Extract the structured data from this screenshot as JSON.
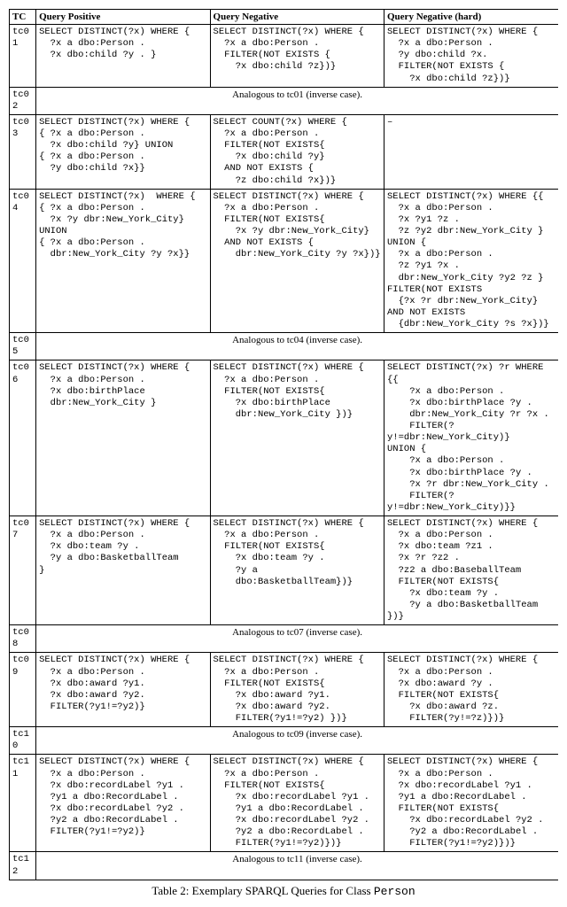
{
  "headers": {
    "tc": "TC",
    "pos": "Query Positive",
    "neg": "Query Negative",
    "negh": "Query Negative (hard)"
  },
  "rows": {
    "tc01": {
      "tc": "tc01",
      "pos": "SELECT DISTINCT(?x) WHERE {\n  ?x a dbo:Person .\n  ?x dbo:child ?y . }",
      "neg": "SELECT DISTINCT(?x) WHERE {\n  ?x a dbo:Person .\n  FILTER(NOT EXISTS {\n    ?x dbo:child ?z})}",
      "negh": "SELECT DISTINCT(?x) WHERE {\n  ?x a dbo:Person .\n  ?y dbo:child ?x.\n  FILTER(NOT EXISTS {\n    ?x dbo:child ?z})}"
    },
    "tc02": {
      "tc": "tc02",
      "analog": "Analogous to tc01 (inverse case)."
    },
    "tc03": {
      "tc": "tc03",
      "pos": "SELECT DISTINCT(?x) WHERE {\n{ ?x a dbo:Person .\n  ?x dbo:child ?y} UNION\n{ ?x a dbo:Person .\n  ?y dbo:child ?x}}",
      "neg": "SELECT COUNT(?x) WHERE {\n  ?x a dbo:Person .\n  FILTER(NOT EXISTS{\n    ?x dbo:child ?y}\n  AND NOT EXISTS {\n    ?z dbo:child ?x})}",
      "negh": "–"
    },
    "tc04": {
      "tc": "tc04",
      "pos": "SELECT DISTINCT(?x)  WHERE {\n{ ?x a dbo:Person .\n  ?x ?y dbr:New_York_City}\nUNION\n{ ?x a dbo:Person .\n  dbr:New_York_City ?y ?x}}",
      "neg": "SELECT DISTINCT(?x) WHERE {\n  ?x a dbo:Person .\n  FILTER(NOT EXISTS{\n    ?x ?y dbr:New_York_City}\n  AND NOT EXISTS {\n    dbr:New_York_City ?y ?x})}",
      "negh": "SELECT DISTINCT(?x) WHERE {{\n  ?x a dbo:Person .\n  ?x ?y1 ?z .\n  ?z ?y2 dbr:New_York_City }\nUNION {\n  ?x a dbo:Person .\n  ?z ?y1 ?x .\n  dbr:New_York_City ?y2 ?z }\nFILTER(NOT EXISTS\n  {?x ?r dbr:New_York_City}\nAND NOT EXISTS\n  {dbr:New_York_City ?s ?x})}"
    },
    "tc05": {
      "tc": "tc05",
      "analog": "Analogous to tc04 (inverse case)."
    },
    "tc06": {
      "tc": "tc06",
      "pos": "SELECT DISTINCT(?x) WHERE {\n  ?x a dbo:Person .\n  ?x dbo:birthPlace\n  dbr:New_York_City }",
      "neg": "SELECT DISTINCT(?x) WHERE {\n  ?x a dbo:Person .\n  FILTER(NOT EXISTS{\n    ?x dbo:birthPlace\n    dbr:New_York_City })}",
      "negh": "SELECT DISTINCT(?x) ?r WHERE {{\n    ?x a dbo:Person .\n    ?x dbo:birthPlace ?y .\n    dbr:New_York_City ?r ?x .\n    FILTER(?y!=dbr:New_York_City)}\nUNION {\n    ?x a dbo:Person .\n    ?x dbo:birthPlace ?y .\n    ?x ?r dbr:New_York_City .\n    FILTER(?y!=dbr:New_York_City)}}"
    },
    "tc07": {
      "tc": "tc07",
      "pos": "SELECT DISTINCT(?x) WHERE {\n  ?x a dbo:Person .\n  ?x dbo:team ?y .\n  ?y a dbo:BasketballTeam\n}",
      "neg": "SELECT DISTINCT(?x) WHERE {\n  ?x a dbo:Person .\n  FILTER(NOT EXISTS{\n    ?x dbo:team ?y .\n    ?y a\n    dbo:BasketballTeam})}",
      "negh": "SELECT DISTINCT(?x) WHERE {\n  ?x a dbo:Person .\n  ?x dbo:team ?z1 .\n  ?x ?r ?z2 .\n  ?z2 a dbo:BaseballTeam\n  FILTER(NOT EXISTS{\n    ?x dbo:team ?y .\n    ?y a dbo:BasketballTeam })}"
    },
    "tc08": {
      "tc": "tc08",
      "analog": "Analogous to tc07 (inverse case)."
    },
    "tc09": {
      "tc": "tc09",
      "pos": "SELECT DISTINCT(?x) WHERE {\n  ?x a dbo:Person .\n  ?x dbo:award ?y1.\n  ?x dbo:award ?y2.\n  FILTER(?y1!=?y2)}",
      "neg": "SELECT DISTINCT(?x) WHERE {\n  ?x a dbo:Person .\n  FILTER(NOT EXISTS{\n    ?x dbo:award ?y1.\n    ?x dbo:award ?y2.\n    FILTER(?y1!=?y2) })}",
      "negh": "SELECT DISTINCT(?x) WHERE {\n  ?x a dbo:Person .\n  ?x dbo:award ?y .\n  FILTER(NOT EXISTS{\n    ?x dbo:award ?z.\n    FILTER(?y!=?z)})}"
    },
    "tc10": {
      "tc": "tc10",
      "analog": "Analogous to tc09 (inverse case)."
    },
    "tc11": {
      "tc": "tc11",
      "pos": "SELECT DISTINCT(?x) WHERE {\n  ?x a dbo:Person .\n  ?x dbo:recordLabel ?y1 .\n  ?y1 a dbo:RecordLabel .\n  ?x dbo:recordLabel ?y2 .\n  ?y2 a dbo:RecordLabel .\n  FILTER(?y1!=?y2)}",
      "neg": "SELECT DISTINCT(?x) WHERE {\n  ?x a dbo:Person .\n  FILTER(NOT EXISTS{\n    ?x dbo:recordLabel ?y1 .\n    ?y1 a dbo:RecordLabel .\n    ?x dbo:recordLabel ?y2 .\n    ?y2 a dbo:RecordLabel .\n    FILTER(?y1!=?y2)})}",
      "negh": "SELECT DISTINCT(?x) WHERE {\n  ?x a dbo:Person .\n  ?x dbo:recordLabel ?y1 .\n  ?y1 a dbo:RecordLabel .\n  FILTER(NOT EXISTS{\n    ?x dbo:recordLabel ?y2 .\n    ?y2 a dbo:RecordLabel .\n    FILTER(?y1!=?y2)})}"
    },
    "tc12": {
      "tc": "tc12",
      "analog": "Analogous to tc11 (inverse case)."
    }
  },
  "caption": {
    "prefix": "Table 2: Exemplary SPARQL Queries for Class ",
    "class": "Person"
  }
}
